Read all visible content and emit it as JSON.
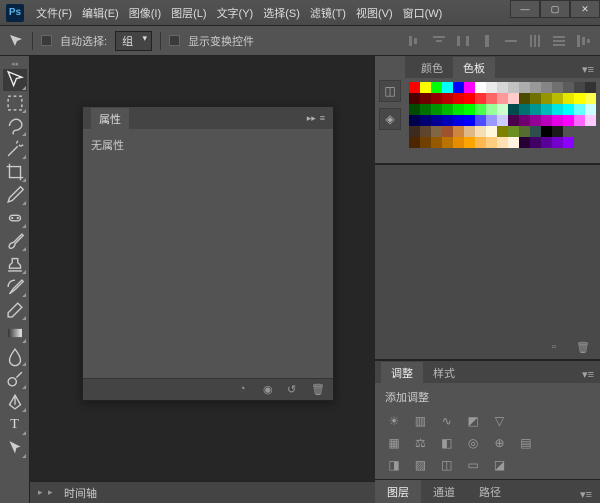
{
  "title_logo": "Ps",
  "menu": [
    "文件(F)",
    "编辑(E)",
    "图像(I)",
    "图层(L)",
    "文字(Y)",
    "选择(S)",
    "滤镜(T)",
    "视图(V)",
    "窗口(W)"
  ],
  "win_buttons": {
    "minimize": "—",
    "maximize": "▢",
    "close": "✕"
  },
  "options": {
    "auto_select_label": "自动选择:",
    "group_label": "组",
    "show_transform_label": "显示变换控件"
  },
  "tools": [
    "move",
    "marquee",
    "lasso",
    "wand",
    "crop",
    "eyedrop",
    "heal",
    "brush",
    "stamp",
    "history",
    "eraser",
    "gradient",
    "blur",
    "dodge",
    "pen",
    "type",
    "path",
    "shape",
    "hand",
    "zoom"
  ],
  "properties": {
    "tab": "属性",
    "body": "无属性"
  },
  "timeline": {
    "tab": "时间轴"
  },
  "color_panel": {
    "tabs": [
      "颜色",
      "色板"
    ],
    "active": 1
  },
  "swatch_colors": [
    "#ff0000",
    "#ffff00",
    "#00ff00",
    "#00ffff",
    "#0000ff",
    "#ff00ff",
    "#ffffff",
    "#ebebeb",
    "#d6d6d6",
    "#c2c2c2",
    "#adadad",
    "#999999",
    "#858585",
    "#707070",
    "#5c5c5c",
    "#474747",
    "#333333",
    "#4b0000",
    "#700000",
    "#950000",
    "#ba0000",
    "#e60000",
    "#ff0000",
    "#ff3333",
    "#ff6666",
    "#ff9999",
    "#ffcccc",
    "#4b4b00",
    "#707000",
    "#959500",
    "#baba00",
    "#e6e600",
    "#ffff00",
    "#ffff4d",
    "#004b00",
    "#007000",
    "#009500",
    "#00ba00",
    "#00e600",
    "#00ff00",
    "#4dff4d",
    "#99ff99",
    "#ccffcc",
    "#004b4b",
    "#007070",
    "#009595",
    "#00baba",
    "#00e6e6",
    "#00ffff",
    "#66ffff",
    "#ccffff",
    "#00004b",
    "#000070",
    "#000095",
    "#0000ba",
    "#0000e6",
    "#0000ff",
    "#4d4dff",
    "#9999ff",
    "#ccccff",
    "#4b004b",
    "#700070",
    "#950095",
    "#ba00ba",
    "#e600e6",
    "#ff00ff",
    "#ff66ff",
    "#ffccff",
    "#3d2b1f",
    "#5e452c",
    "#826644",
    "#a0522d",
    "#cd853f",
    "#deb887",
    "#f5deb3",
    "#fff8dc",
    "#808000",
    "#6b8e23",
    "#556b2f",
    "#2f4f4f",
    "#000000",
    "#1a1a1a",
    "",
    "",
    "",
    "#4b2600",
    "#704000",
    "#955900",
    "#ba7300",
    "#e68c00",
    "#ffa500",
    "#ffb84d",
    "#ffcc80",
    "#ffe0b3",
    "#fff2e0",
    "#260033",
    "#400066",
    "#590099",
    "#7300cc",
    "#8c00ff",
    "",
    "",
    ""
  ],
  "adjustments": {
    "tabs": [
      "调整",
      "样式"
    ],
    "active": 0,
    "label": "添加调整"
  },
  "layers": {
    "tabs": [
      "图层",
      "通道",
      "路径"
    ],
    "active": 0
  }
}
